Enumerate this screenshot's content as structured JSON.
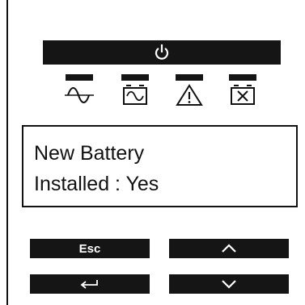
{
  "status_indicators": [
    {
      "name": "line",
      "icon": "ac-sine-wave-icon"
    },
    {
      "name": "battery-mode",
      "icon": "battery-wave-icon"
    },
    {
      "name": "warning",
      "icon": "warning-triangle-icon"
    },
    {
      "name": "fault",
      "icon": "battery-fault-icon"
    }
  ],
  "power_icon": "power-icon",
  "lcd": {
    "line1": "New Battery",
    "line2": "Installed : Yes"
  },
  "buttons": {
    "esc_label": "Esc",
    "up_icon": "chevron-up-icon",
    "enter_icon": "enter-arrow-icon",
    "down_icon": "chevron-down-icon"
  },
  "colors": {
    "panel_dark": "#151515",
    "text": "#111111",
    "background": "#ffffff"
  }
}
